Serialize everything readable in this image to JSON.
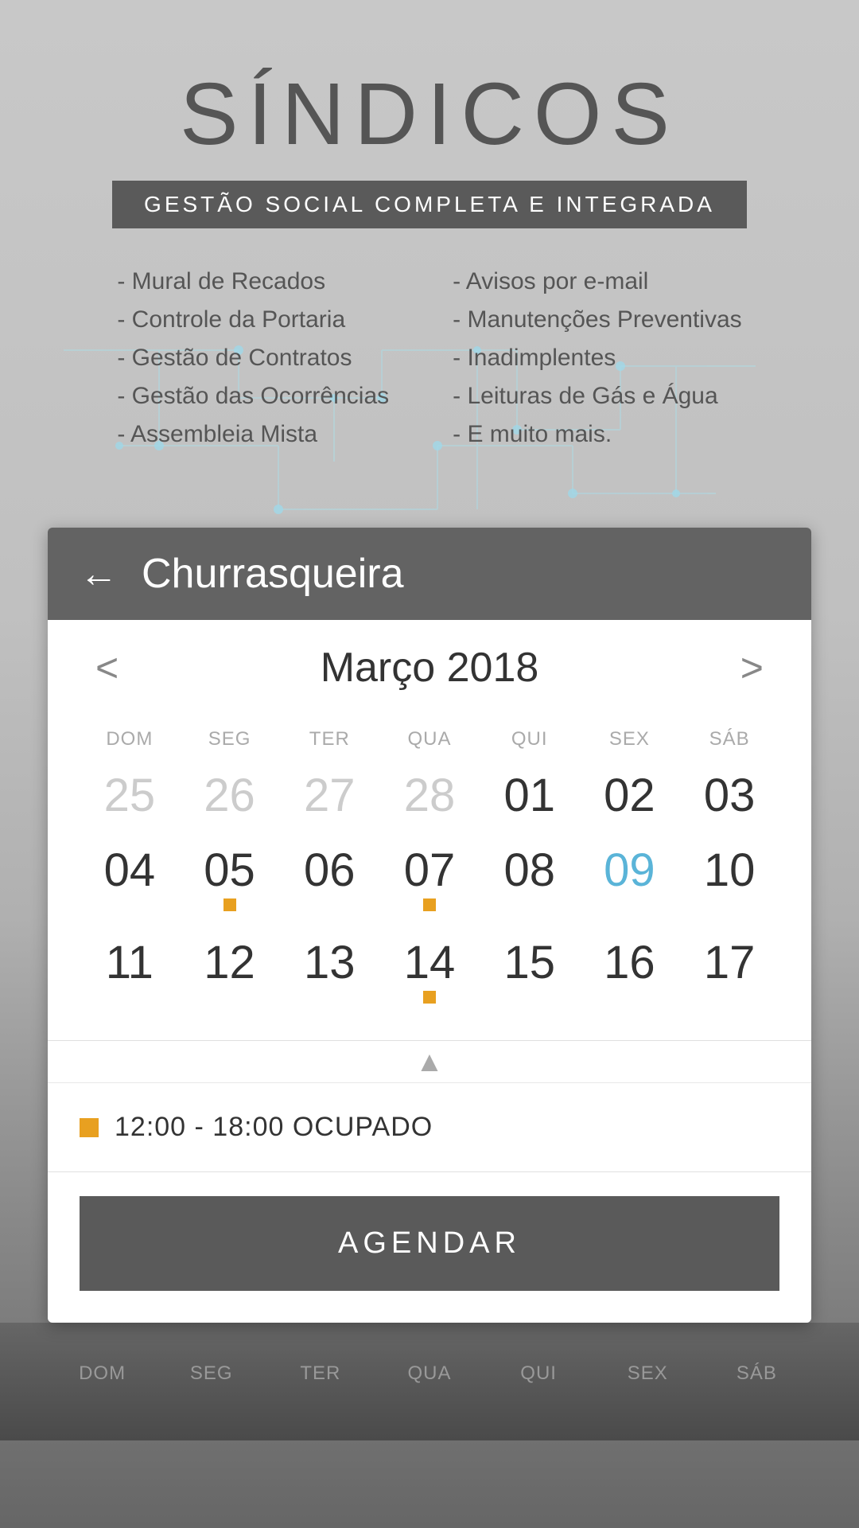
{
  "app": {
    "title": "SÍNDICOS",
    "subtitle": "GESTÃO SOCIAL COMPLETA E INTEGRADA"
  },
  "features": {
    "left": [
      "- Mural de Recados",
      "- Controle da Portaria",
      "- Gestão de Contratos",
      "- Gestão das Ocorrências",
      "- Assembleia Mista"
    ],
    "right": [
      "- Avisos por e-mail",
      "- Manutenções Preventivas",
      "- Inadimplentes",
      "- Leituras de Gás e Água",
      "- E muito mais."
    ]
  },
  "calendar": {
    "back_label": "←",
    "room_name": "Churrasqueira",
    "month_label": "Março 2018",
    "prev_arrow": "<",
    "next_arrow": ">",
    "weekdays": [
      "DOM",
      "SEG",
      "TER",
      "QUA",
      "QUI",
      "SEX",
      "SÁB"
    ],
    "weeks": [
      [
        {
          "num": "25",
          "dimmed": true,
          "dot": false
        },
        {
          "num": "26",
          "dimmed": true,
          "dot": false
        },
        {
          "num": "27",
          "dimmed": true,
          "dot": false
        },
        {
          "num": "28",
          "dimmed": true,
          "dot": false
        },
        {
          "num": "01",
          "dimmed": false,
          "dot": false
        },
        {
          "num": "02",
          "dimmed": false,
          "dot": false
        },
        {
          "num": "03",
          "dimmed": false,
          "dot": false
        }
      ],
      [
        {
          "num": "04",
          "dimmed": false,
          "dot": false
        },
        {
          "num": "05",
          "dimmed": false,
          "dot": true
        },
        {
          "num": "06",
          "dimmed": false,
          "dot": false
        },
        {
          "num": "07",
          "dimmed": false,
          "dot": true
        },
        {
          "num": "08",
          "dimmed": false,
          "dot": false
        },
        {
          "num": "09",
          "dimmed": false,
          "dot": false,
          "blue": true
        },
        {
          "num": "10",
          "dimmed": false,
          "dot": false
        }
      ],
      [
        {
          "num": "11",
          "dimmed": false,
          "dot": false
        },
        {
          "num": "12",
          "dimmed": false,
          "dot": false
        },
        {
          "num": "13",
          "dimmed": false,
          "dot": false
        },
        {
          "num": "14",
          "dimmed": false,
          "dot": true
        },
        {
          "num": "15",
          "dimmed": false,
          "dot": false
        },
        {
          "num": "16",
          "dimmed": false,
          "dot": false
        },
        {
          "num": "17",
          "dimmed": false,
          "dot": false
        }
      ]
    ],
    "booking": {
      "time_range": "12:00 - 18:00 OCUPADO"
    },
    "agendar_label": "AGENDAR",
    "chevron": "▲"
  },
  "bottom_weekdays": [
    "DOM",
    "SEG",
    "TER",
    "QUA",
    "QUI",
    "SEX",
    "SÁB"
  ]
}
